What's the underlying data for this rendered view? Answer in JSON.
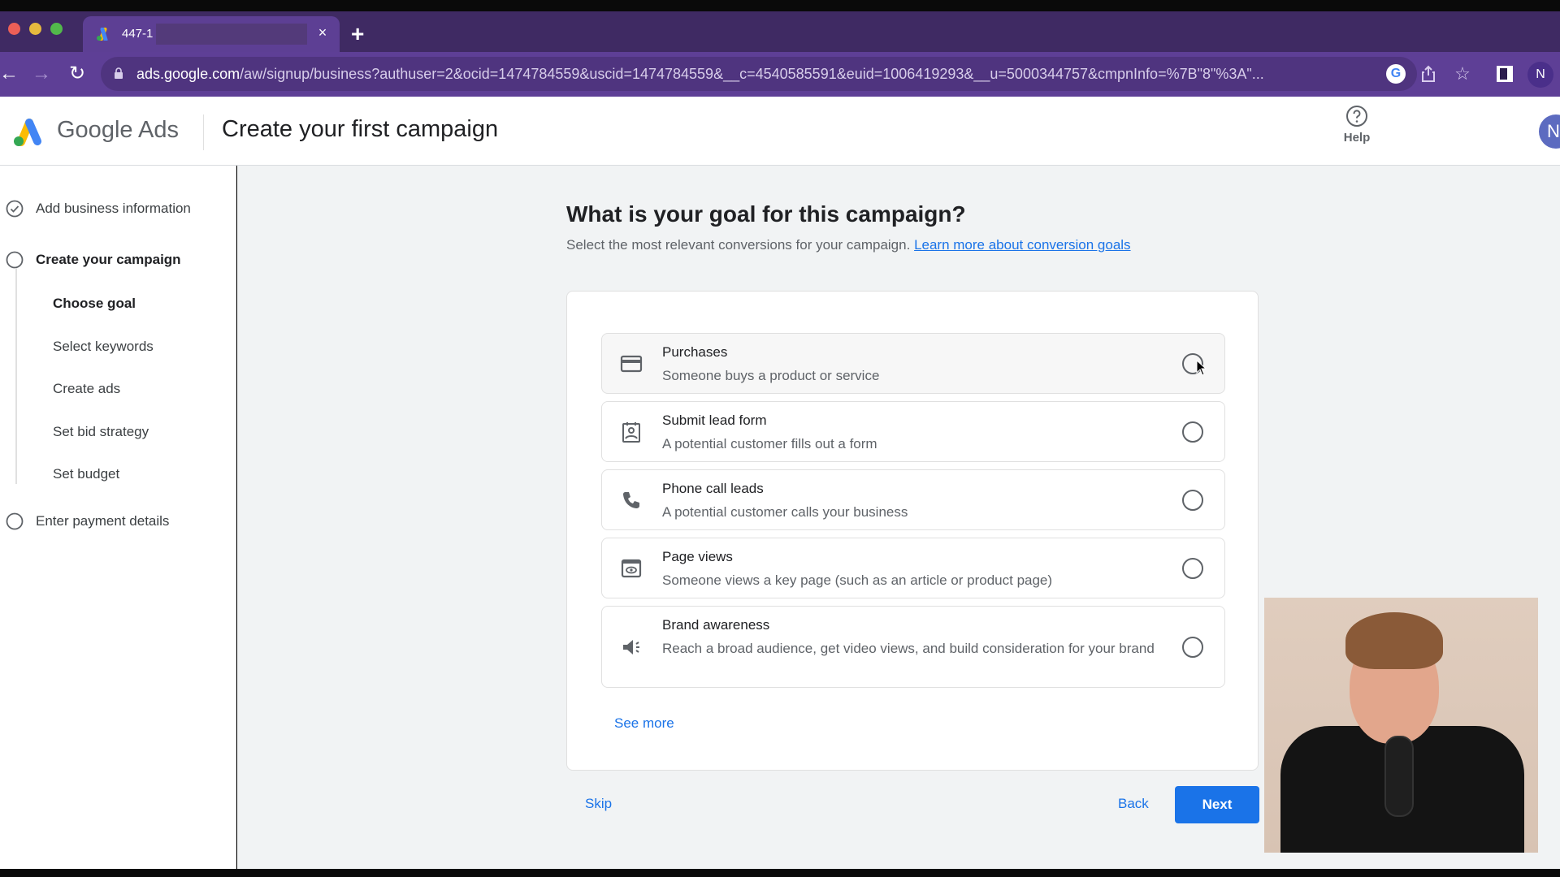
{
  "browser": {
    "tab_title": "447-1",
    "tab_close": "×",
    "new_tab": "+",
    "url_host": "ads.google.com",
    "url_path": "/aw/signup/business?authuser=2&ocid=1474784559&uscid=1474784559&__c=4540585591&euid=1006419293&__u=5000344757&cmpnInfo=%7B\"8\"%3A\"...",
    "profile_initial": "N",
    "google_icon_label": "G",
    "star_icon": "☆",
    "back_icon": "←",
    "forward_icon": "→",
    "reload_icon": "↻"
  },
  "header": {
    "brand": "Google Ads",
    "title": "Create your first campaign",
    "help_label": "Help",
    "avatar_initial": "N"
  },
  "sidebar": {
    "steps": [
      {
        "label": "Add business information",
        "status": "completed",
        "icon": "check-circle-icon"
      },
      {
        "label": "Create your campaign",
        "status": "current",
        "icon": "circle-icon"
      },
      {
        "label": "Enter payment details",
        "status": "pending",
        "icon": "circle-icon"
      }
    ],
    "substeps": [
      {
        "label": "Choose goal",
        "active": true
      },
      {
        "label": "Select keywords",
        "active": false
      },
      {
        "label": "Create ads",
        "active": false
      },
      {
        "label": "Set bid strategy",
        "active": false
      },
      {
        "label": "Set budget",
        "active": false
      }
    ]
  },
  "main": {
    "question": "What is your goal for this campaign?",
    "subtitle": "Select the most relevant conversions for your campaign.",
    "learn_more": "Learn more about conversion goals",
    "options": [
      {
        "title": "Purchases",
        "description": "Someone buys a product or service",
        "icon": "credit-card-icon",
        "selected": false
      },
      {
        "title": "Submit lead form",
        "description": "A potential customer fills out a form",
        "icon": "contact-form-icon",
        "selected": false
      },
      {
        "title": "Phone call leads",
        "description": "A potential customer calls your business",
        "icon": "phone-icon",
        "selected": false
      },
      {
        "title": "Page views",
        "description": "Someone views a key page (such as an article or product page)",
        "icon": "page-view-icon",
        "selected": false
      },
      {
        "title": "Brand awareness",
        "description": "Reach a broad audience, get video views, and build consideration for your brand",
        "icon": "megaphone-icon",
        "selected": false
      }
    ],
    "see_more": "See more",
    "skip": "Skip",
    "back": "Back",
    "next": "Next"
  },
  "colors": {
    "accent": "#1a73e8",
    "browser_frame": "#5e3f96",
    "page_background": "#f1f3f4"
  }
}
